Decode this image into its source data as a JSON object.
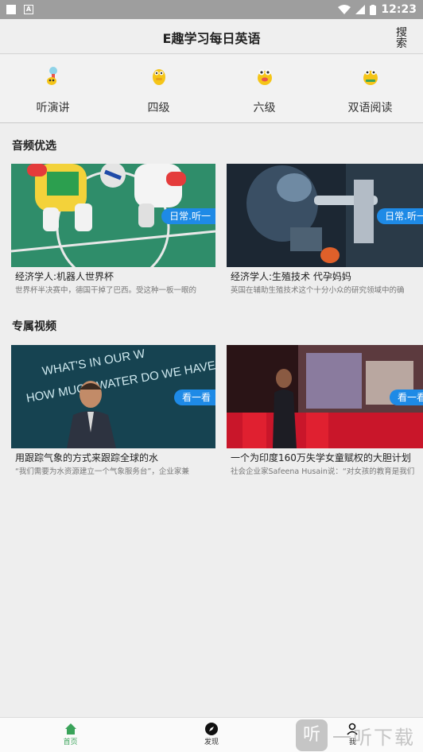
{
  "status": {
    "time": "12:23"
  },
  "header": {
    "title": "E趣学习每日英语",
    "search_label": "搜索"
  },
  "categories": [
    {
      "label": "听演讲",
      "icon": "microphone-mascot-icon"
    },
    {
      "label": "四级",
      "icon": "mascot-icon"
    },
    {
      "label": "六级",
      "icon": "mascot-icon"
    },
    {
      "label": "双语阅读",
      "icon": "mascot-icon"
    }
  ],
  "audio": {
    "title": "音频优选",
    "cards": [
      {
        "title": "经济学人:机器人世界杯",
        "desc": "世界杯半决赛中，德国干掉了巴西。受这种一板一眼的",
        "tag": "日常.听一"
      },
      {
        "title": "经济学人:生殖技术 代孕妈妈",
        "desc": "英国在辅助生殖技术这个十分小众的研究领域中的确",
        "tag": "日常.听一"
      }
    ]
  },
  "video": {
    "title": "专属视频",
    "cards": [
      {
        "title": "用跟踪气象的方式来跟踪全球的水",
        "desc": "“我们需要为水资源建立一个气象服务台”，企业家兼",
        "tag": "看一看",
        "slide_text_1": "WHAT'S IN OUR W",
        "slide_text_2": "HOW MUCH WATER DO WE HAVE?"
      },
      {
        "title": "一个为印度160万失学女童赋权的大胆计划",
        "desc": "社会企业家Safeena Husain说：“对女孩的教育是我们",
        "tag": "看一看"
      }
    ]
  },
  "nav": {
    "tabs": [
      {
        "label": "首页",
        "icon": "home-icon",
        "active": true
      },
      {
        "label": "发现",
        "icon": "compass-icon",
        "active": false
      },
      {
        "label": "我",
        "icon": "person-icon",
        "active": false
      }
    ]
  },
  "watermark": {
    "text": "一听下载",
    "badge": "听"
  },
  "colors": {
    "tag_blue": "#1e8ae6",
    "active_green": "#3aa35a",
    "mascot_yellow": "#f5c518"
  }
}
